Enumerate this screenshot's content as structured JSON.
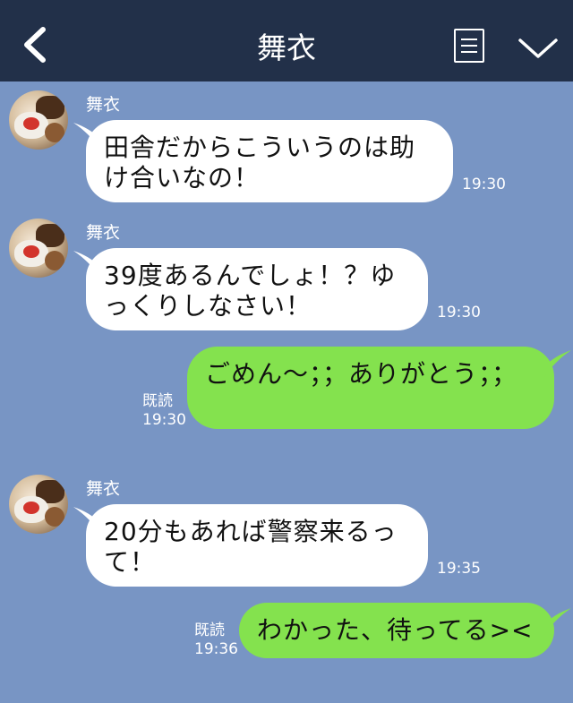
{
  "header": {
    "title": "舞衣"
  },
  "messages": [
    {
      "sender": "舞衣",
      "text": "田舎だからこういうのは助け合いなの！",
      "time": "19:30"
    },
    {
      "sender": "舞衣",
      "text": "39度あるんでしょ！？ゆっくりしなさい！",
      "time": "19:30"
    },
    {
      "text": "ごめん～；；ありがとう；；",
      "read": "既読",
      "time": "19:30"
    },
    {
      "sender": "舞衣",
      "text": "20分もあれば警察来るって！",
      "time": "19:35"
    },
    {
      "text": "わかった、待ってる><",
      "read": "既読",
      "time": "19:36"
    }
  ],
  "colors": {
    "header_bg": "#223049",
    "chat_bg": "#7895c4",
    "incoming_bubble": "#ffffff",
    "outgoing_bubble": "#84e24e"
  },
  "icons": {
    "back": "back-chevron-icon",
    "menu": "menu-icon",
    "collapse": "chevron-down-icon"
  }
}
